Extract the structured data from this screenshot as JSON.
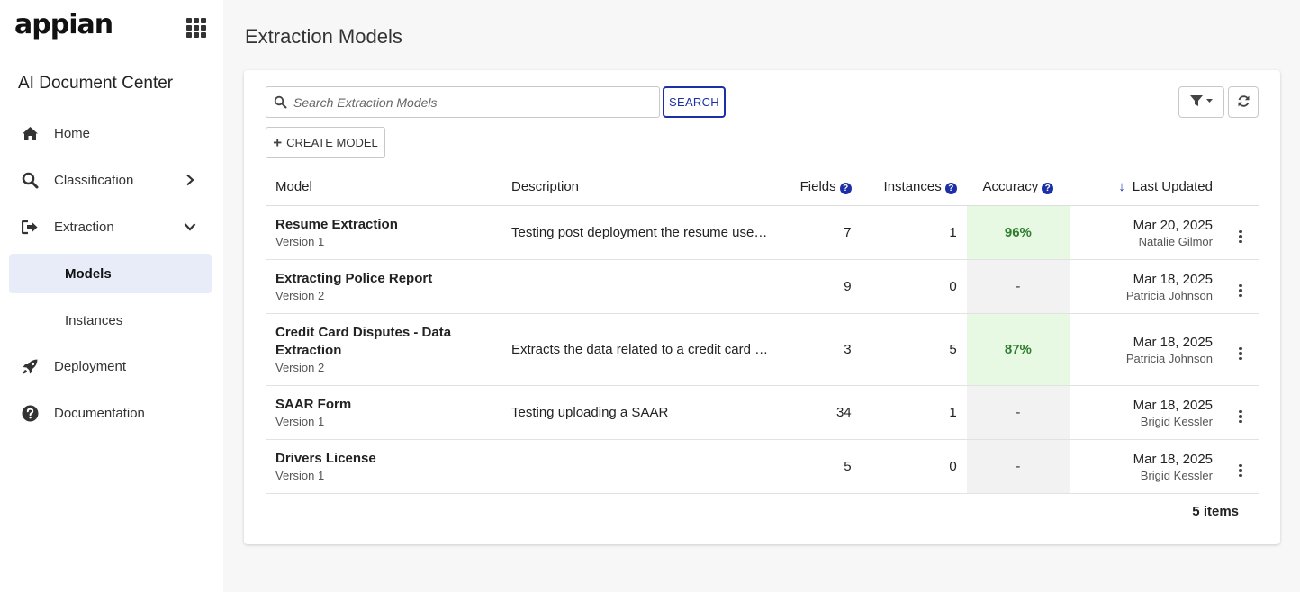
{
  "app": {
    "logo": "appian",
    "title": "AI Document Center"
  },
  "sidebar": {
    "items": [
      {
        "label": "Home",
        "icon": "home-icon"
      },
      {
        "label": "Classification",
        "icon": "search-icon",
        "chevron": "right"
      },
      {
        "label": "Extraction",
        "icon": "extraction-icon",
        "chevron": "down"
      },
      {
        "label": "Models",
        "sub": true,
        "active": true
      },
      {
        "label": "Instances",
        "sub": true
      },
      {
        "label": "Deployment",
        "icon": "rocket-icon"
      },
      {
        "label": "Documentation",
        "icon": "question-icon"
      }
    ]
  },
  "page": {
    "title": "Extraction Models"
  },
  "toolbar": {
    "search_placeholder": "Search Extraction Models",
    "search_value": "",
    "search_label": "SEARCH",
    "create_label": "CREATE MODEL"
  },
  "table": {
    "headers": {
      "model": "Model",
      "description": "Description",
      "fields": "Fields",
      "instances": "Instances",
      "accuracy": "Accuracy",
      "last_updated": "Last Updated"
    },
    "rows": [
      {
        "name": "Resume Extraction",
        "version": "Version 1",
        "description": "Testing post deployment the resume use ca...",
        "fields": "7",
        "instances": "1",
        "accuracy": "96%",
        "accuracy_good": true,
        "date": "Mar 20, 2025",
        "by": "Natalie Gilmor"
      },
      {
        "name": "Extracting Police Report",
        "version": "Version 2",
        "description": "",
        "fields": "9",
        "instances": "0",
        "accuracy": "-",
        "accuracy_good": false,
        "date": "Mar 18, 2025",
        "by": "Patricia Johnson"
      },
      {
        "name": "Credit Card Disputes - Data Extraction",
        "version": "Version 2",
        "description": "Extracts the data related to a credit card di...",
        "fields": "3",
        "instances": "5",
        "accuracy": "87%",
        "accuracy_good": true,
        "date": "Mar 18, 2025",
        "by": "Patricia Johnson"
      },
      {
        "name": "SAAR Form",
        "version": "Version 1",
        "description": "Testing uploading a SAAR",
        "fields": "34",
        "instances": "1",
        "accuracy": "-",
        "accuracy_good": false,
        "date": "Mar 18, 2025",
        "by": "Brigid Kessler"
      },
      {
        "name": "Drivers License",
        "version": "Version 1",
        "description": "",
        "fields": "5",
        "instances": "0",
        "accuracy": "-",
        "accuracy_good": false,
        "date": "Mar 18, 2025",
        "by": "Brigid Kessler"
      }
    ],
    "count_num": "5",
    "count_label": "items"
  },
  "colors": {
    "accent": "#1d2fa6",
    "accuracy_good_bg": "#e7f8e3",
    "accuracy_good_text": "#2e7d2e",
    "active_nav_bg": "#e8ebf8"
  }
}
